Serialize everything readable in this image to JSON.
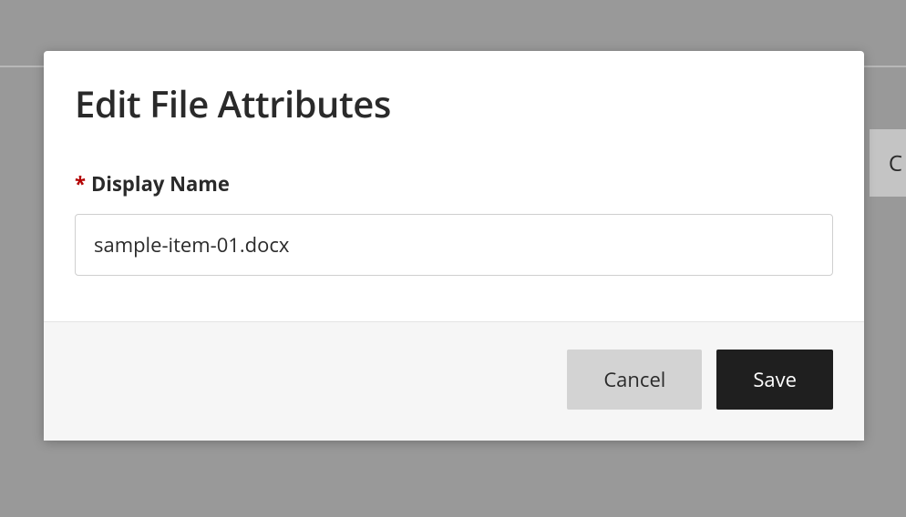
{
  "modal": {
    "title": "Edit File Attributes",
    "fields": {
      "display_name": {
        "label": "Display Name",
        "required_marker": "*",
        "value": "sample-item-01.docx"
      }
    },
    "buttons": {
      "cancel": "Cancel",
      "save": "Save"
    }
  },
  "backdrop": {
    "partial_button_text": "C"
  }
}
